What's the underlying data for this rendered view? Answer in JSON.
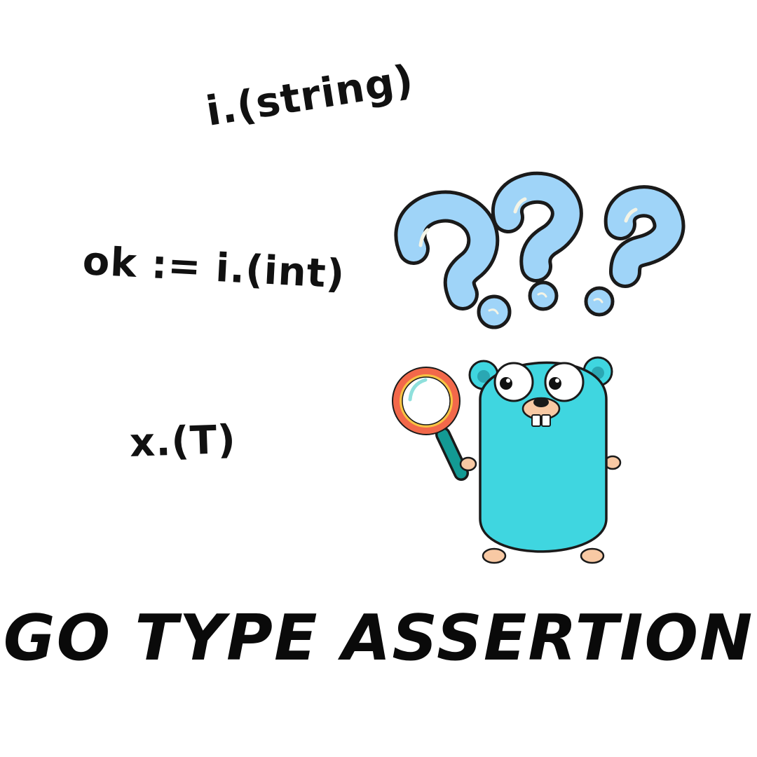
{
  "code_snippets": [
    {
      "text": "i.(string)"
    },
    {
      "text": "ok := i.(int)"
    },
    {
      "text": "x.(T)"
    }
  ],
  "title": "GO TYPE ASSERTION",
  "illustration": {
    "subject": "gopher-mascot",
    "icons": [
      "question-mark-icon",
      "question-mark-icon",
      "question-mark-icon",
      "magnifying-glass-icon"
    ]
  },
  "colors": {
    "text": "#111111",
    "question_fill": "#9fd4f8",
    "gopher_body": "#3fd6e0",
    "magnifier_ring": "#f2684a",
    "magnifier_handle": "#139a94",
    "skin": "#f8c9a4"
  }
}
